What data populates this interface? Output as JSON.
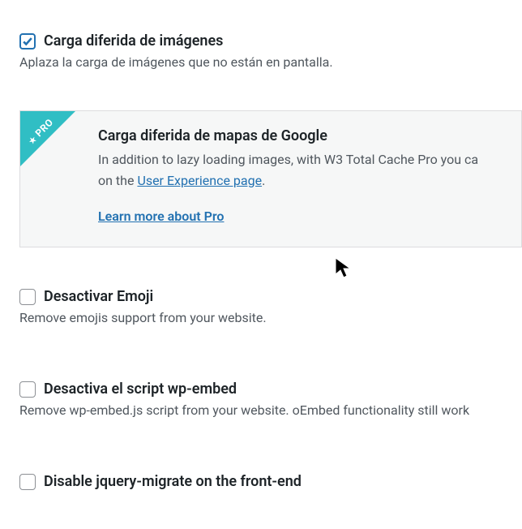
{
  "options": {
    "lazy_images": {
      "title": "Carga diferida de imágenes",
      "desc": "Aplaza la carga de imágenes que no están en pantalla."
    },
    "disable_emoji": {
      "title": "Desactivar Emoji",
      "desc": "Remove emojis support from your website."
    },
    "disable_wp_embed": {
      "title": "Desactiva el script wp-embed",
      "desc": "Remove wp-embed.js script from your website. oEmbed functionality still work"
    },
    "disable_jquery_migrate": {
      "title": "Disable jquery-migrate on the front-end"
    }
  },
  "pro_box": {
    "ribbon": "PRO",
    "title": "Carga diferida de mapas de Google",
    "desc_prefix": "In addition to lazy loading images, with W3 Total Cache Pro you ca",
    "desc_line2_prefix": "on the ",
    "link_label": "User Experience page",
    "desc_line2_suffix": ".",
    "learn_more": "Learn more about Pro"
  }
}
